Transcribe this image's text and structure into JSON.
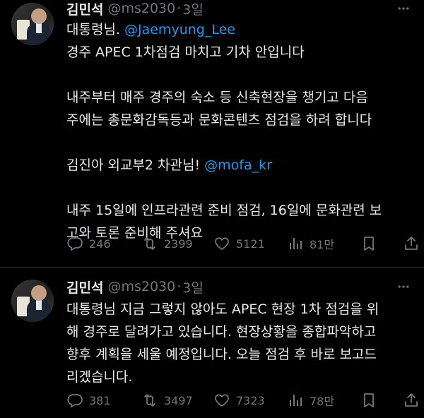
{
  "tweets": [
    {
      "name": "김민석",
      "handle": "@ms2030",
      "dot": "·",
      "time": "3일",
      "lines": [
        {
          "segments": [
            {
              "text": "대통령님. ",
              "type": "text"
            },
            {
              "text": "@Jaemyung_Lee",
              "type": "mention"
            }
          ]
        },
        {
          "segments": [
            {
              "text": "경주 APEC 1차점검 마치고 기차 안입니다",
              "type": "text"
            }
          ]
        },
        {
          "blank": true
        },
        {
          "segments": [
            {
              "text": "내주부터 매주 경주의 숙소 등 신축현장을 챙기고 다음",
              "type": "text"
            }
          ]
        },
        {
          "segments": [
            {
              "text": "주에는 총문화감독등과 문화콘텐츠 점검을 하려 합니다",
              "type": "text"
            }
          ]
        },
        {
          "blank": true
        },
        {
          "segments": [
            {
              "text": "김진아 외교부2 차관님! ",
              "type": "text"
            },
            {
              "text": "@mofa_kr",
              "type": "mention"
            }
          ]
        },
        {
          "blank": true
        },
        {
          "segments": [
            {
              "text": "내주 15일에 인프라관련 준비 점검, 16일에 문화관련 보",
              "type": "text"
            }
          ]
        },
        {
          "segments": [
            {
              "text": "고와 토론 준비해 주셔요",
              "type": "text"
            }
          ]
        }
      ],
      "actions": {
        "reply": "246",
        "retweet": "2399",
        "like": "5121",
        "views": "81만"
      }
    },
    {
      "name": "김민석",
      "handle": "@ms2030",
      "dot": "·",
      "time": "3일",
      "lines": [
        {
          "segments": [
            {
              "text": "대통령님 지금 그렇지 않아도 APEC 현장 1차 점검을 위",
              "type": "text"
            }
          ]
        },
        {
          "segments": [
            {
              "text": "해 경주로 달려가고 있습니다. 현장상황을 종합파악하고",
              "type": "text"
            }
          ]
        },
        {
          "segments": [
            {
              "text": "향후 계획을 세울 예정입니다. 오늘 점검 후 바로 보고드",
              "type": "text"
            }
          ]
        },
        {
          "segments": [
            {
              "text": "리겠습니다.",
              "type": "text"
            }
          ]
        }
      ],
      "actions": {
        "reply": "381",
        "retweet": "3497",
        "like": "7323",
        "views": "78만"
      }
    }
  ]
}
